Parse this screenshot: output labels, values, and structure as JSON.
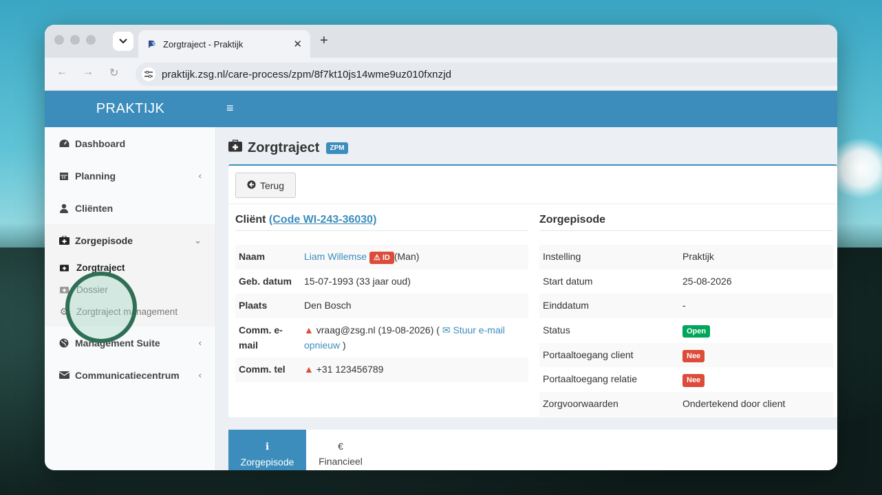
{
  "browser": {
    "tab_title": "Zorgtraject - Praktijk",
    "url": "praktijk.zsg.nl/care-process/zpm/8f7kt10js14wme9uz010fxnzjd",
    "new_tab": "+",
    "close": "✕"
  },
  "app": {
    "brand": "PRAKTIJK",
    "hamburger": "≡"
  },
  "sidebar": {
    "items": [
      {
        "label": "Dashboard",
        "icon": "dashboard-icon"
      },
      {
        "label": "Planning",
        "icon": "calendar-icon",
        "chevron": "‹"
      },
      {
        "label": "Cliënten",
        "icon": "user-icon"
      },
      {
        "label": "Zorgepisode",
        "icon": "medkit-icon",
        "chevron": "⌄"
      },
      {
        "label": "Management Suite",
        "icon": "globe-icon",
        "chevron": "‹"
      },
      {
        "label": "Communicatiecentrum",
        "icon": "envelope-icon",
        "chevron": "‹"
      }
    ],
    "sub": [
      {
        "label": "Zorgtraject"
      },
      {
        "label": "Dossier"
      },
      {
        "label": "Zorgtraject management"
      }
    ]
  },
  "page": {
    "title": "Zorgtraject",
    "badge": "ZPM",
    "back_label": "Terug"
  },
  "client": {
    "heading": "Cliënt",
    "code_link": "(Code WI-243-36030)",
    "rows": {
      "naam_k": "Naam",
      "naam_v": "Liam Willemse",
      "id_badge": "ID",
      "gender": "(Man)",
      "geb_k": "Geb. datum",
      "geb_v": "15-07-1993 (33 jaar oud)",
      "plaats_k": "Plaats",
      "plaats_v": "Den Bosch",
      "email_k": "Comm. e-mail",
      "email_v": "vraag@zsg.nl (19-08-2026) (",
      "email_link": "Stuur e-mail opnieuw",
      "email_end": ")",
      "tel_k": "Comm. tel",
      "tel_v": "+31 123456789"
    }
  },
  "episode": {
    "heading": "Zorgepisode",
    "rows": [
      {
        "k": "Instelling",
        "v": "Praktijk"
      },
      {
        "k": "Start datum",
        "v": "25-08-2026"
      },
      {
        "k": "Einddatum",
        "v": "-"
      },
      {
        "k": "Status",
        "v": "Open",
        "badge": "green"
      },
      {
        "k": "Portaaltoegang client",
        "v": "Nee",
        "badge": "red"
      },
      {
        "k": "Portaaltoegang relatie",
        "v": "Nee",
        "badge": "red"
      },
      {
        "k": "Zorgvoorwaarden",
        "v": "Ondertekend door client"
      }
    ]
  },
  "tabs": [
    {
      "label": "Zorgepisode",
      "icon": "ℹ"
    },
    {
      "label": "Financieel",
      "icon": "€"
    }
  ]
}
